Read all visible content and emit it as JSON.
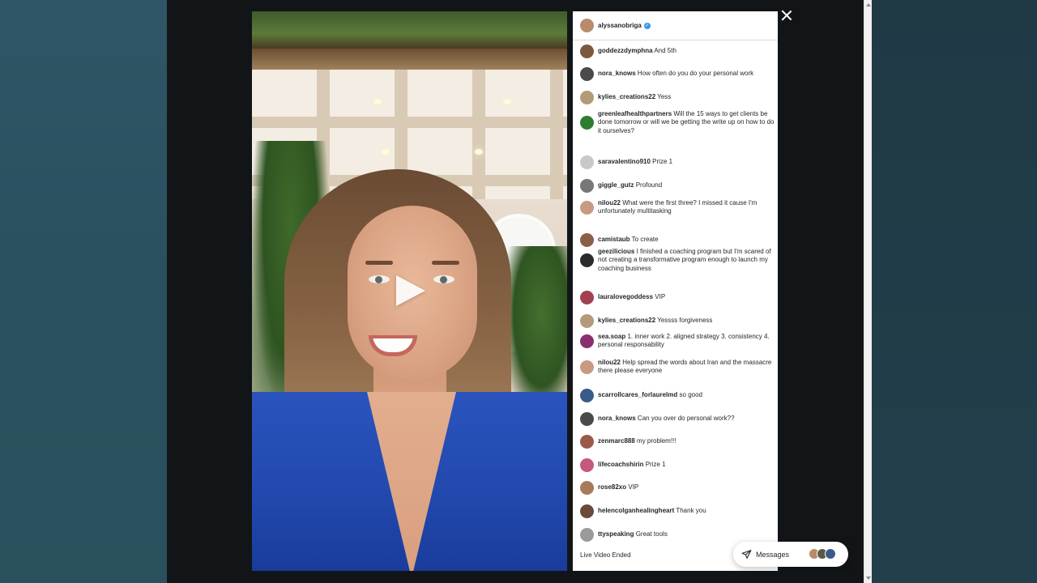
{
  "panel": {
    "host": {
      "username": "alyssanobriga",
      "verified": true,
      "avatar_color": "#b98a6c"
    },
    "comments": [
      {
        "username": "goddezzdymphna",
        "text": "And 5th",
        "avatar_color": "#7a5a3e"
      },
      {
        "username": "nora_knows",
        "text": "How often do you do your personal work",
        "avatar_color": "#4a4a4a"
      },
      {
        "username": "kylies_creations22",
        "text": "Yess",
        "avatar_color": "#b39a78"
      },
      {
        "username": "greenleafhealthpartners",
        "text": "Will the 15 ways to get clients be done tomorrow or will we be getting the write up on how to do it ourselves?",
        "avatar_color": "#2e7d32"
      },
      {
        "username": "saravalentino910",
        "text": "Prize 1",
        "avatar_color": "#c8c8c8"
      },
      {
        "username": "giggle_gutz",
        "text": "Profound",
        "avatar_color": "#777777"
      },
      {
        "username": "nilou22",
        "text": "What were the first three? I missed it cause I'm unfortunately multitasking",
        "avatar_color": "#c89a82"
      },
      {
        "username": "camistaub",
        "text": "To create",
        "avatar_color": "#8a5e48"
      },
      {
        "username": "geezilicious",
        "text": "I finished a coaching program but I'm scared of not creating a transformative program enough to launch my coaching business",
        "avatar_color": "#2b2b2b"
      },
      {
        "username": "lauralovegoddess",
        "text": "VIP",
        "avatar_color": "#a04050"
      },
      {
        "username": "kylies_creations22",
        "text": "Yessss forgiveness",
        "avatar_color": "#b39a78"
      },
      {
        "username": "sea.soap",
        "text": "1. inner work 2. aligned strategy 3. consistency 4. personal responsability",
        "avatar_color": "#8a2f6e"
      },
      {
        "username": "nilou22",
        "text": "Help spread the words about Iran and the massacre there please everyone",
        "avatar_color": "#c89a82"
      },
      {
        "username": "scarrollcares_forlaurelmd",
        "text": "so good",
        "avatar_color": "#3a5a8a"
      },
      {
        "username": "nora_knows",
        "text": "Can you over do personal work??",
        "avatar_color": "#4a4a4a"
      },
      {
        "username": "zenmarc888",
        "text": "my problem!!!",
        "avatar_color": "#9a5a4a"
      },
      {
        "username": "lifecoachshirin",
        "text": "Prize 1",
        "avatar_color": "#c45a7a"
      },
      {
        "username": "rose82xo",
        "text": "VIP",
        "avatar_color": "#a87a5a"
      },
      {
        "username": "helencolganhealingheart",
        "text": "Thank you",
        "avatar_color": "#6a4a3a"
      },
      {
        "username": "ttyspeaking",
        "text": "Great tools",
        "avatar_color": "#9a9a9a"
      }
    ],
    "status": "Live Video Ended"
  },
  "messages": {
    "label": "Messages",
    "icon": "paper-plane-icon"
  },
  "close": {
    "icon": "close-icon"
  },
  "video": {
    "state": "paused",
    "icon": "play-icon"
  },
  "colors": {
    "accent": "#3897f0",
    "backdrop": "#121518",
    "panel": "#ffffff"
  }
}
